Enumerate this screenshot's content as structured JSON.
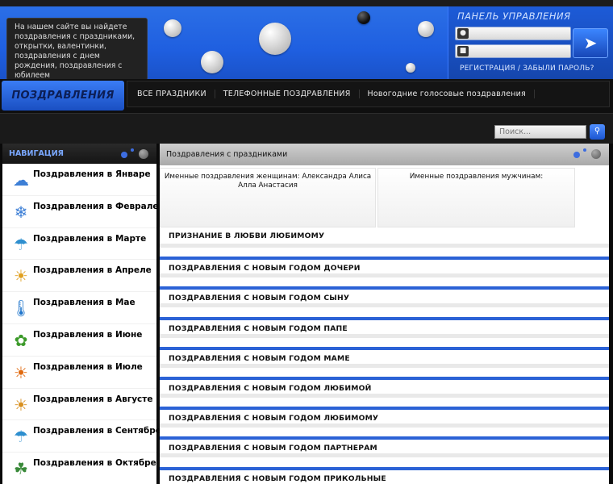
{
  "intro_text": "На нашем сайте вы найдете поздравления с праздниками, открытки, валентинки, поздравления с днем рождения, поздравления с юбилеем",
  "panel": {
    "title": "ПАНЕЛЬ УПРАВЛЕНИЯ",
    "login_icon": "user-icon",
    "password_icon": "lock-icon",
    "submit_icon": "arrow-right-icon",
    "links": "РЕГИСТРАЦИЯ / ЗАБЫЛИ ПАРОЛЬ?"
  },
  "logo": "ПОЗДРАВЛЕНИЯ",
  "menu": [
    "ВСЕ ПРАЗДНИКИ",
    "ТЕЛЕФОННЫЕ ПОЗДРАВЛЕНИЯ",
    "Новогодние голосовые поздравления"
  ],
  "search": {
    "placeholder": "Поиск..."
  },
  "sidebar": {
    "title": "НАВИГАЦИЯ",
    "items": [
      {
        "label": "Поздравления в Январе",
        "icon": "snow-cloud-icon"
      },
      {
        "label": "Поздравления в Феврале",
        "icon": "snow-cloud-icon"
      },
      {
        "label": "Поздравления в Марте",
        "icon": "rain-cloud-icon"
      },
      {
        "label": "Поздравления в Апреле",
        "icon": "rainbow-icon"
      },
      {
        "label": "Поздравления в Мае",
        "icon": "thermometer-icon"
      },
      {
        "label": "Поздравления в Июне",
        "icon": "grass-icon"
      },
      {
        "label": "Поздравления в Июле",
        "icon": "sun-icon"
      },
      {
        "label": "Поздравления в Августе",
        "icon": "sun-icon"
      },
      {
        "label": "Поздравления в Сентябре",
        "icon": "rain-cloud-icon"
      },
      {
        "label": "Поздравления в Октябре",
        "icon": "tree-icon"
      }
    ]
  },
  "main": {
    "title": "Поздравления с праздниками",
    "women": "Именные поздравления женщинам: Александра Алиса Алла Анастасия",
    "men": "Именные поздравления мужчинам:",
    "posts": [
      "ПРИЗНАНИЕ В ЛЮБВИ ЛЮБИМОМУ",
      "ПОЗДРАВЛЕНИЯ С НОВЫМ ГОДОМ ДОЧЕРИ",
      "ПОЗДРАВЛЕНИЯ С НОВЫМ ГОДОМ СЫНУ",
      "ПОЗДРАВЛЕНИЯ С НОВЫМ ГОДОМ ПАПЕ",
      "ПОЗДРАВЛЕНИЯ С НОВЫМ ГОДОМ МАМЕ",
      "ПОЗДРАВЛЕНИЯ С НОВЫМ ГОДОМ ЛЮБИМОЙ",
      "ПОЗДРАВЛЕНИЯ С НОВЫМ ГОДОМ ЛЮБИМОМУ",
      "ПОЗДРАВЛЕНИЯ С НОВЫМ ГОДОМ ПАРТНЕРАМ",
      "ПОЗДРАВЛЕНИЯ С НОВЫМ ГОДОМ ПРИКОЛЬНЫЕ"
    ]
  }
}
